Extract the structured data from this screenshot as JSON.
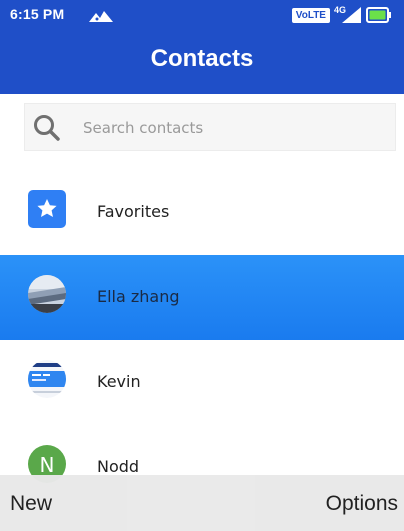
{
  "status_bar": {
    "time": "6:15 PM",
    "volte_label": "VoLTE",
    "network_label": "4G",
    "icons": [
      "notification-icon",
      "signal-icon",
      "battery-icon"
    ]
  },
  "header": {
    "title": "Contacts"
  },
  "search": {
    "placeholder": "Search contacts",
    "icon": "search-icon"
  },
  "list": {
    "items": [
      {
        "label": "Favorites",
        "icon": "star-icon",
        "selected": false
      },
      {
        "label": "Ella zhang",
        "icon": "avatar-photo",
        "selected": true
      },
      {
        "label": "Kevin",
        "icon": "avatar-photo",
        "selected": false
      },
      {
        "label": "Nodd",
        "avatar_letter": "N",
        "selected": false
      }
    ]
  },
  "softkeys": {
    "left": "New",
    "right": "Options"
  },
  "colors": {
    "header_bg": "#1f4fc8",
    "selected_bg": "#2b92f8",
    "favorites_badge": "#2f7ff4",
    "letter_avatar_bg": "#5aa84a",
    "softkey_bg": "#e9e9e9"
  }
}
